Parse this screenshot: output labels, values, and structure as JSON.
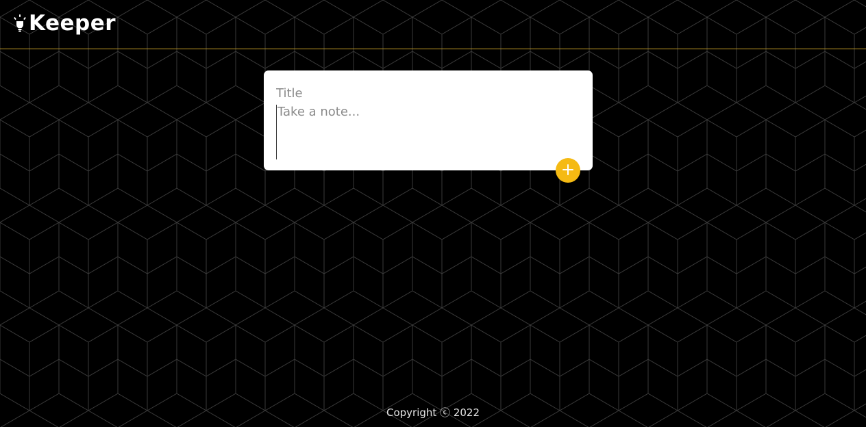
{
  "app": {
    "name": "Keeper"
  },
  "icons": {
    "logo": "lightbulb-icon",
    "add": "plus-icon"
  },
  "form": {
    "title_placeholder": "Title",
    "title_value": "",
    "note_placeholder": "Take a note...",
    "note_value": ""
  },
  "footer": {
    "copyright": "Copyright ⓒ 2022"
  },
  "colors": {
    "background": "#000000",
    "accent": "#f5ba13",
    "header_border": "#c9a227",
    "card": "#ffffff"
  }
}
